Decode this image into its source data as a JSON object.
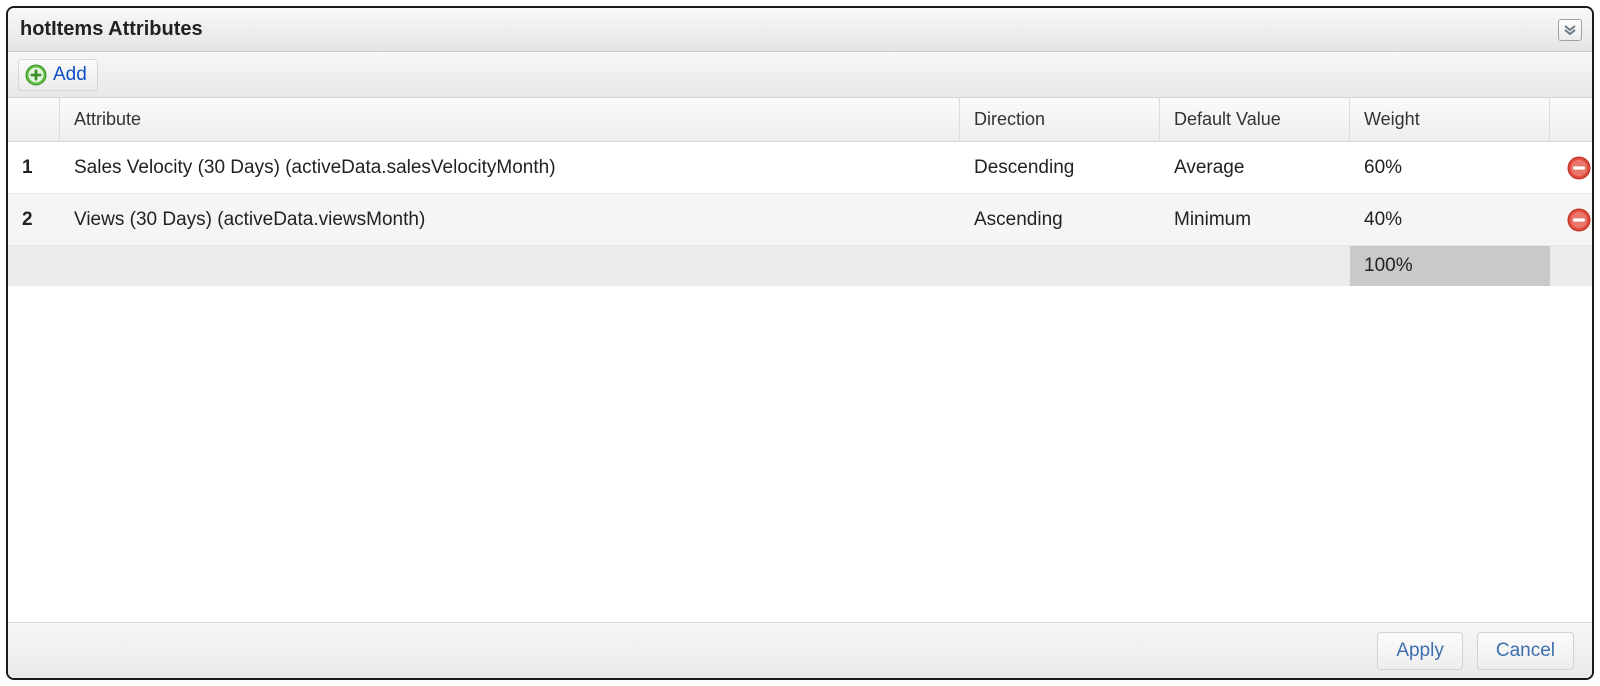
{
  "panel": {
    "title": "hotItems Attributes"
  },
  "toolbar": {
    "add_label": "Add"
  },
  "grid": {
    "headers": {
      "attribute": "Attribute",
      "direction": "Direction",
      "default_value": "Default Value",
      "weight": "Weight"
    },
    "rows": [
      {
        "index": "1",
        "attribute": "Sales Velocity (30 Days) (activeData.salesVelocityMonth)",
        "direction": "Descending",
        "default_value": "Average",
        "weight": "60%"
      },
      {
        "index": "2",
        "attribute": "Views (30 Days) (activeData.viewsMonth)",
        "direction": "Ascending",
        "default_value": "Minimum",
        "weight": "40%"
      }
    ],
    "total_weight": "100%"
  },
  "buttons": {
    "apply": "Apply",
    "cancel": "Cancel"
  }
}
